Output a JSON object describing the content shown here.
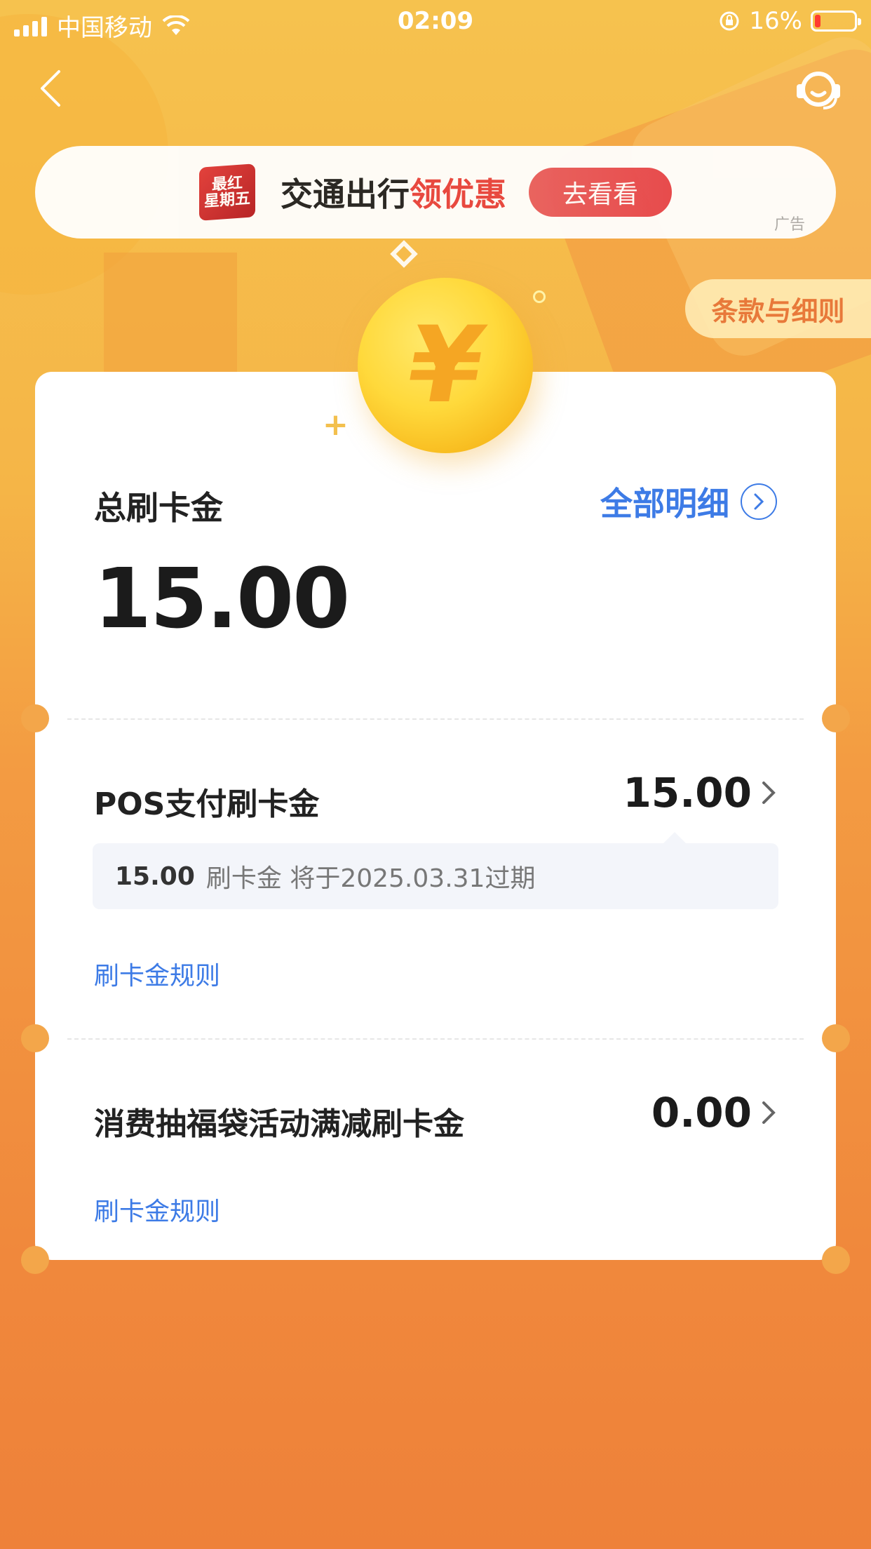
{
  "status_bar": {
    "carrier": "中国移动",
    "time": "02:09",
    "battery_percent": "16%"
  },
  "ad": {
    "logo_text_line1": "最红",
    "logo_text_line2": "星期五",
    "text_main": "交通出行",
    "text_highlight": "领优惠",
    "button_label": "去看看",
    "tag": "广告"
  },
  "terms_label": "条款与细则",
  "summary": {
    "title": "总刷卡金",
    "detail_link": "全部明细",
    "total": "15.00"
  },
  "items": [
    {
      "label": "POS支付刷卡金",
      "value": "15.00",
      "expire_amount": "15.00",
      "expire_text": "刷卡金  将于2025.03.31过期",
      "rule_link": "刷卡金规则"
    },
    {
      "label": "消费抽福袋活动满减刷卡金",
      "value": "0.00",
      "rule_link": "刷卡金规则"
    }
  ],
  "colors": {
    "accent_blue": "#3d7be6",
    "ad_red": "#e8433f",
    "terms_orange": "#e8793a"
  },
  "icons": {
    "back": "chevron-left-icon",
    "support": "headset-icon",
    "coin": "yen-coin-icon",
    "chevron": "chevron-right-icon"
  }
}
